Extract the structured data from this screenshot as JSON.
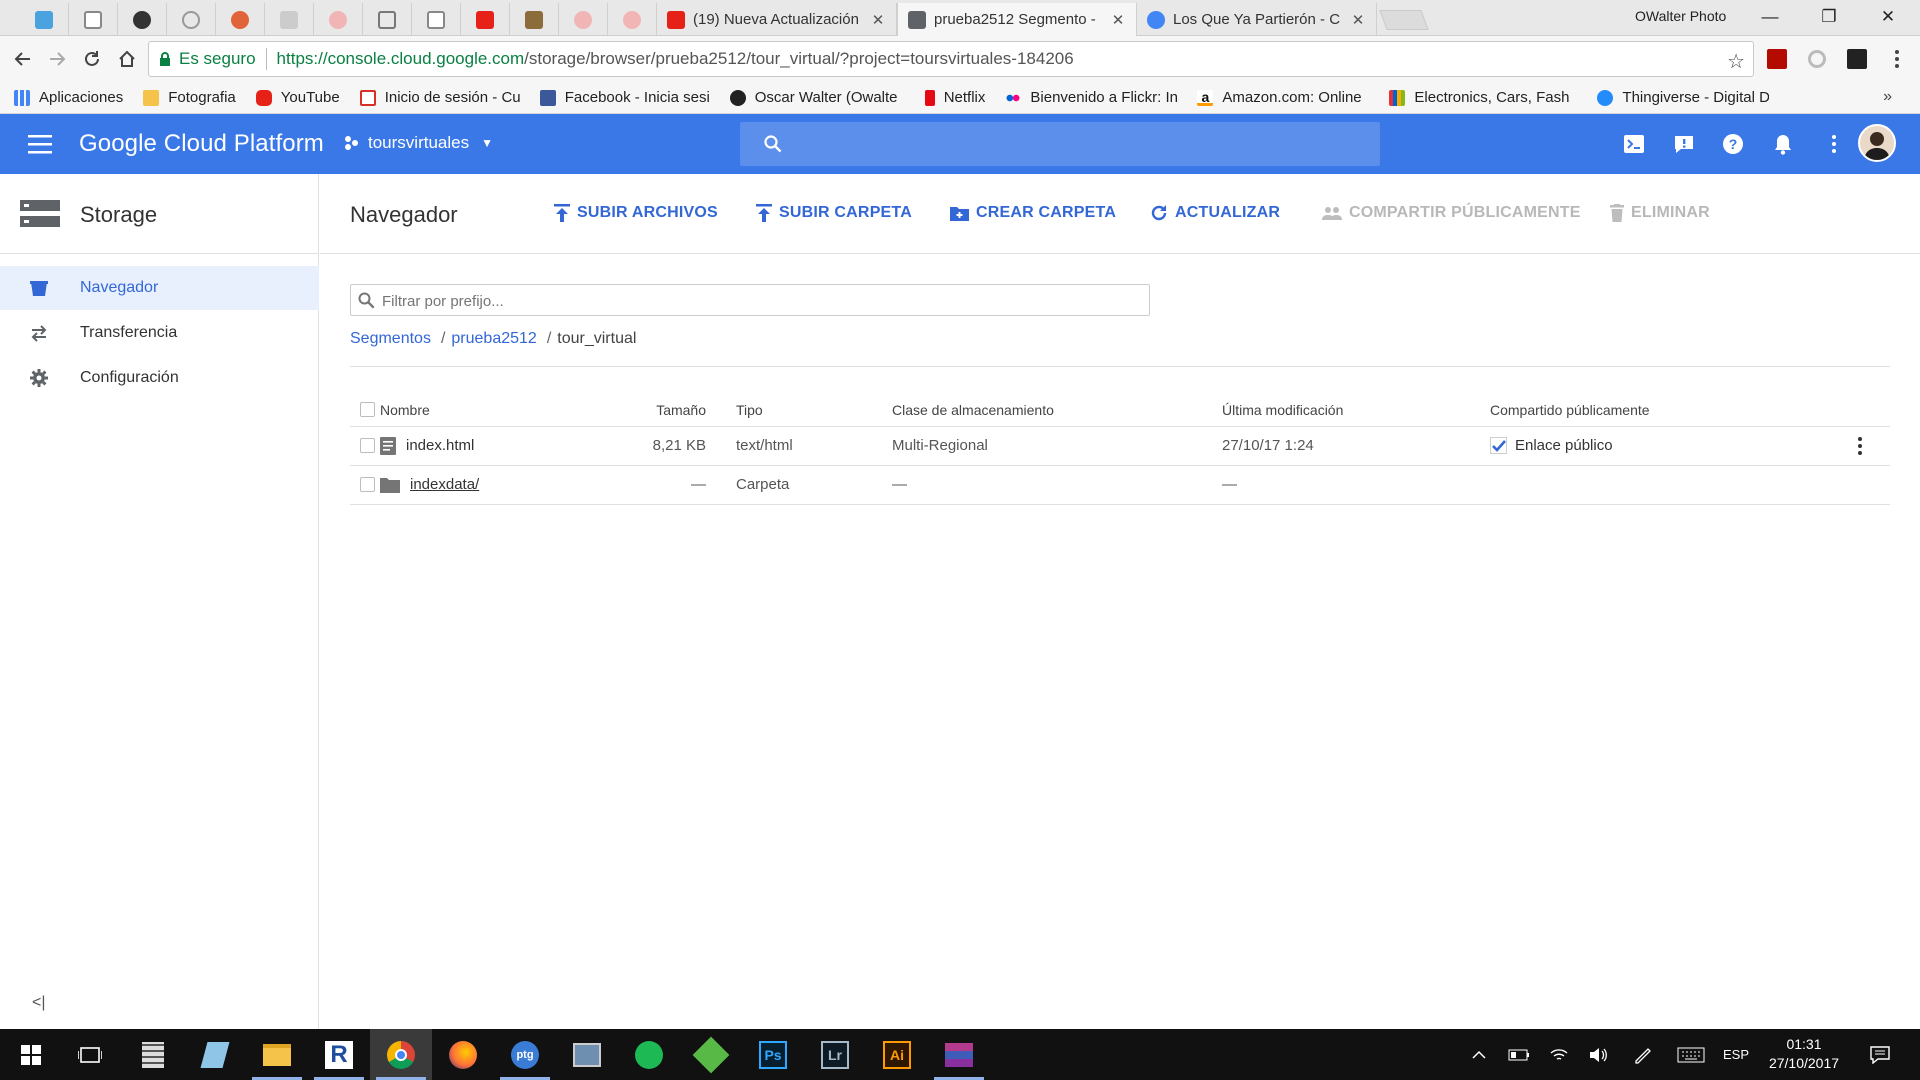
{
  "browser": {
    "profile": "OWalter Photo",
    "tabs": [
      {
        "title": "(19) Nueva Actualización",
        "favicon_color": "#e62117"
      },
      {
        "title": "prueba2512 Segmento -",
        "favicon_color": "#5f6368"
      },
      {
        "title": "Los Que Ya Partierón - C",
        "favicon_color": "#4285f4"
      }
    ],
    "secure_label": "Es seguro",
    "url_host": "https://console.cloud.google.com",
    "url_path": "/storage/browser/prueba2512/tour_virtual/?project=toursvirtuales-184206",
    "bookmarks": [
      {
        "label": "Aplicaciones",
        "icon": "apps-grid-icon",
        "color": "#4285f4"
      },
      {
        "label": "Fotografia",
        "icon": "folder-icon",
        "color": "#f5c34a"
      },
      {
        "label": "YouTube",
        "icon": "youtube-icon",
        "color": "#e62117"
      },
      {
        "label": "Inicio de sesión - Cue",
        "icon": "gmail-icon",
        "color": "#d93025"
      },
      {
        "label": "Facebook - Inicia sesi",
        "icon": "facebook-icon",
        "color": "#3b5998"
      },
      {
        "label": "Oscar Walter (Owalte",
        "icon": "500px-icon",
        "color": "#222222"
      },
      {
        "label": "Netflix",
        "icon": "netflix-icon",
        "color": "#e50914"
      },
      {
        "label": "Bienvenido a Flickr: In",
        "icon": "flickr-icon",
        "color": "#ff0084"
      },
      {
        "label": "Amazon.com: Online",
        "icon": "amazon-icon",
        "color": "#111111"
      },
      {
        "label": "Electronics, Cars, Fash",
        "icon": "ebay-icon",
        "color": "#e53238"
      },
      {
        "label": "Thingiverse - Digital D",
        "icon": "thingiverse-icon",
        "color": "#248bfb"
      }
    ]
  },
  "gcp": {
    "brand": "Google Cloud Platform",
    "project": "toursvirtuales",
    "accent": "#3b78e7",
    "search_placeholder": ""
  },
  "sidebar": {
    "product": "Storage",
    "items": [
      {
        "label": "Navegador",
        "icon": "bucket-icon",
        "active": true
      },
      {
        "label": "Transferencia",
        "icon": "transfer-icon",
        "active": false
      },
      {
        "label": "Configuración",
        "icon": "gear-icon",
        "active": false
      }
    ]
  },
  "main": {
    "title": "Navegador",
    "actions": [
      {
        "label": "SUBIR ARCHIVOS",
        "icon": "upload-icon",
        "enabled": true
      },
      {
        "label": "SUBIR CARPETA",
        "icon": "upload-folder-icon",
        "enabled": true
      },
      {
        "label": "CREAR CARPETA",
        "icon": "create-folder-icon",
        "enabled": true
      },
      {
        "label": "ACTUALIZAR",
        "icon": "refresh-icon",
        "enabled": true
      },
      {
        "label": "COMPARTIR PÚBLICAMENTE",
        "icon": "share-people-icon",
        "enabled": false
      },
      {
        "label": "ELIMINAR",
        "icon": "trash-icon",
        "enabled": false
      }
    ],
    "filter_placeholder": "Filtrar por prefijo...",
    "breadcrumb": {
      "root": "Segmentos",
      "bucket": "prueba2512",
      "current": "tour_virtual"
    },
    "table": {
      "headers": [
        "Nombre",
        "Tamaño",
        "Tipo",
        "Clase de almacenamiento",
        "Última modificación",
        "Compartido públicamente"
      ],
      "rows": [
        {
          "name": "index.html",
          "size": "8,21 KB",
          "type": "text/html",
          "class": "Multi-Regional",
          "modified": "27/10/17 1:24",
          "shared": "Enlace público",
          "kind": "file"
        },
        {
          "name": "indexdata/",
          "size": "—",
          "type": "Carpeta",
          "class": "—",
          "modified": "—",
          "shared": "",
          "kind": "folder"
        }
      ]
    }
  },
  "taskbar": {
    "language": "ESP",
    "time": "01:31",
    "date": "27/10/2017"
  }
}
